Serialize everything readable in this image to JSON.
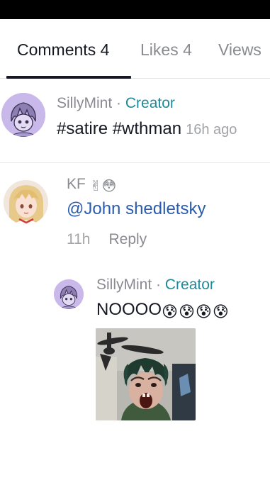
{
  "tabs": [
    {
      "label": "Comments 4"
    },
    {
      "label": "Likes 4"
    },
    {
      "label": "Views"
    }
  ],
  "comments": [
    {
      "author": "SillyMint",
      "separator": "·",
      "role": "Creator",
      "text": "#satire #wthman",
      "time": "16h ago",
      "avatar_icon": "anime-sketch-avatar"
    },
    {
      "author": "KF",
      "author_emojis": "✌😳",
      "text": "@John shedletsky",
      "time": "11h",
      "reply_label": "Reply",
      "avatar_icon": "anime-girl-avatar"
    },
    {
      "author": "SillyMint",
      "separator": "·",
      "role": "Creator",
      "text": "NOOOO",
      "text_emojis": "😰😰😰😰",
      "avatar_icon": "anime-sketch-avatar",
      "image_icon": "screaming-man-photo"
    }
  ],
  "colors": {
    "creator": "#1f8a99",
    "mention": "#2b5cae",
    "muted": "#8a8b91",
    "text": "#161823"
  }
}
